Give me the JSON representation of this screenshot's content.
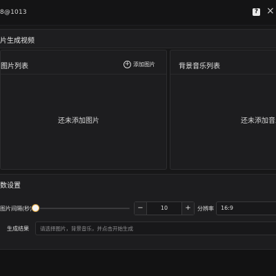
{
  "window": {
    "title": "8@1013",
    "help_icon": "?",
    "close_icon": "×",
    "icons": {
      "help": "help-icon",
      "close": "close-icon"
    }
  },
  "main_section": {
    "title": "片生成视频"
  },
  "image_panel": {
    "title": "图片列表",
    "add_button": "添加图片",
    "empty_text": "还未添加图片",
    "icons": {
      "add": "plus-circle-icon"
    }
  },
  "music_panel": {
    "title": "背景音乐列表",
    "empty_text": "还未添加音乐"
  },
  "settings": {
    "title": "数设置",
    "interval_label": "图片间隔(秒)",
    "slider_value": 0,
    "stepper": {
      "minus": "−",
      "value": "10",
      "plus": "+"
    },
    "resolution_label": "分辨率",
    "resolution_value": "16:9",
    "result_label": "生成结果",
    "result_placeholder": "请选择图片，背景音乐，并点击开始生成"
  },
  "colors": {
    "background": "#171718",
    "panel": "#1d1d1f",
    "border": "#2d2d2f",
    "text": "#e6e6e6",
    "slider_accent": "#f3b54a"
  }
}
